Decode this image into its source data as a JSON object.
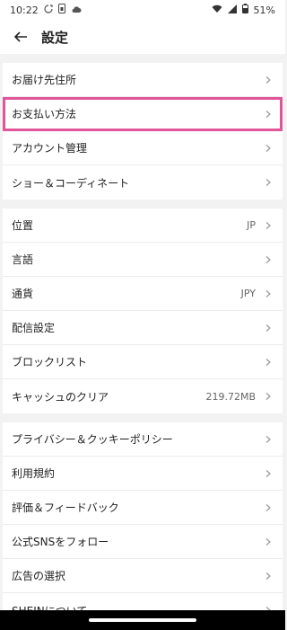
{
  "status_bar": {
    "time": "10:22",
    "battery": "51%",
    "icons": [
      "sync-icon",
      "sim-icon",
      "cloud-icon",
      "wifi-icon",
      "signal-icon",
      "battery-icon"
    ]
  },
  "header": {
    "title": "設定"
  },
  "sections": [
    [
      {
        "label": "お届け先住所"
      },
      {
        "label": "お支払い方法"
      },
      {
        "label": "アカウント管理"
      },
      {
        "label": "ショー＆コーディネート"
      }
    ],
    [
      {
        "label": "位置",
        "value": "JP"
      },
      {
        "label": "言語"
      },
      {
        "label": "通貨",
        "value": "JPY"
      },
      {
        "label": "配信設定"
      },
      {
        "label": "ブロックリスト"
      },
      {
        "label": "キャッシュのクリア",
        "value": "219.72MB"
      }
    ],
    [
      {
        "label": "プライバシー＆クッキーポリシー"
      },
      {
        "label": "利用規約"
      },
      {
        "label": "評価＆フィードバック"
      },
      {
        "label": "公式SNSをフォロー"
      },
      {
        "label": "広告の選択"
      },
      {
        "label": "SHEINについて"
      }
    ]
  ],
  "highlight_color": "#e0559a"
}
